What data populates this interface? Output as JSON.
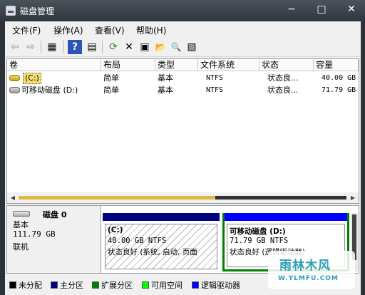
{
  "window": {
    "title": "磁盘管理",
    "min": "−",
    "max": "□",
    "close": "✕"
  },
  "menu": [
    "文件(F)",
    "操作(A)",
    "查看(V)",
    "帮助(H)"
  ],
  "toolbar": {
    "back": "⇦",
    "forward": "⇨",
    "view": "▦",
    "help": "?",
    "panel": "▤",
    "refresh": "⟳",
    "delete": "✕",
    "properties": "▣",
    "open": "📂",
    "find": "🔍",
    "settings": "▧"
  },
  "columns": [
    "卷",
    "布局",
    "类型",
    "文件系统",
    "状态",
    "容量"
  ],
  "volumes": [
    {
      "name": "(C:)",
      "layout": "简单",
      "type": "基本",
      "fs": "NTFS",
      "status": "状态良...",
      "capacity": "40.00 GB"
    },
    {
      "name": "可移动磁盘 (D:)",
      "layout": "简单",
      "type": "基本",
      "fs": "NTFS",
      "status": "状态良...",
      "capacity": "71.79 GB"
    }
  ],
  "scroll": {
    "fill_fraction": 0.6
  },
  "disk": {
    "name": "磁盘 0",
    "type": "基本",
    "size": "111.79 GB",
    "state": "联机"
  },
  "partitions": [
    {
      "title": "(C:)",
      "size": "40.00 GB NTFS",
      "status": "状态良好 (系统, 启动, 页面"
    },
    {
      "title": "可移动磁盘  (D:)",
      "size": "71.79 GB NTFS",
      "status": "状态良好 (逻辑驱动器)"
    }
  ],
  "legend": [
    {
      "label": "未分配",
      "color": "#000000"
    },
    {
      "label": "主分区",
      "color": "#000080"
    },
    {
      "label": "扩展分区",
      "color": "#008000"
    },
    {
      "label": "可用空间",
      "color": "#00ff00"
    },
    {
      "label": "逻辑驱动器",
      "color": "#0000ff"
    }
  ],
  "colors": {
    "primary_stripe": "#000080",
    "logical_stripe": "#0000ff",
    "extended_border": "#008000"
  },
  "watermark": {
    "logo": "雨林木风",
    "url": "W.YLMFU.COM"
  }
}
